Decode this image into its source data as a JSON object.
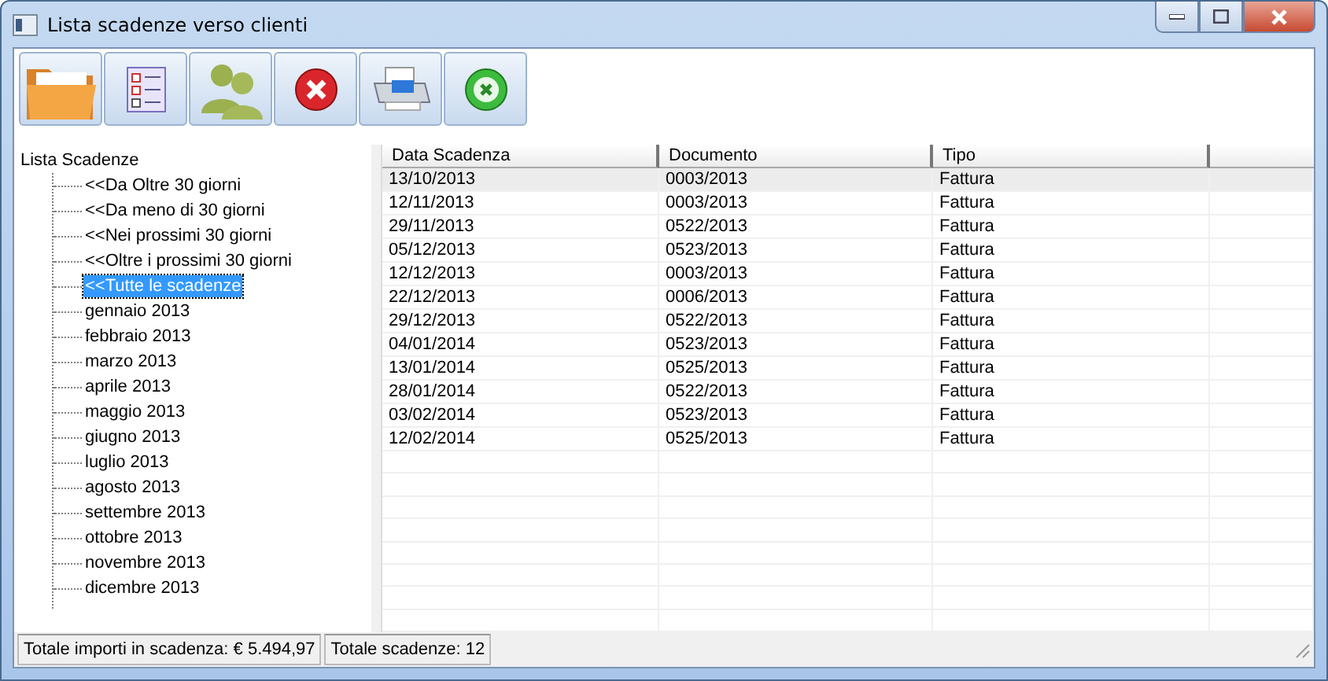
{
  "window": {
    "title": "Lista scadenze verso clienti"
  },
  "tree": {
    "label": "Lista Scadenze",
    "children": [
      {
        "label": "<<Da Oltre 30 giorni",
        "selected": false
      },
      {
        "label": "<<Da meno di 30 giorni",
        "selected": false
      },
      {
        "label": "<<Nei prossimi 30 giorni",
        "selected": false
      },
      {
        "label": "<<Oltre i prossimi 30 giorni",
        "selected": false
      },
      {
        "label": "<<Tutte le scadenze",
        "selected": true
      },
      {
        "label": "gennaio 2013",
        "selected": false
      },
      {
        "label": "febbraio 2013",
        "selected": false
      },
      {
        "label": "marzo 2013",
        "selected": false
      },
      {
        "label": "aprile 2013",
        "selected": false
      },
      {
        "label": "maggio 2013",
        "selected": false
      },
      {
        "label": "giugno 2013",
        "selected": false
      },
      {
        "label": "luglio 2013",
        "selected": false
      },
      {
        "label": "agosto 2013",
        "selected": false
      },
      {
        "label": "settembre 2013",
        "selected": false
      },
      {
        "label": "ottobre 2013",
        "selected": false
      },
      {
        "label": "novembre 2013",
        "selected": false
      },
      {
        "label": "dicembre 2013",
        "selected": false
      }
    ]
  },
  "table": {
    "columns": [
      "Data Scadenza",
      "Documento",
      "Tipo"
    ],
    "rows": [
      {
        "cells": [
          "13/10/2013",
          "0003/2013",
          "Fattura"
        ],
        "selected": true
      },
      {
        "cells": [
          "12/11/2013",
          "0003/2013",
          "Fattura"
        ],
        "selected": false
      },
      {
        "cells": [
          "29/11/2013",
          "0522/2013",
          "Fattura"
        ],
        "selected": false
      },
      {
        "cells": [
          "05/12/2013",
          "0523/2013",
          "Fattura"
        ],
        "selected": false
      },
      {
        "cells": [
          "12/12/2013",
          "0003/2013",
          "Fattura"
        ],
        "selected": false
      },
      {
        "cells": [
          "22/12/2013",
          "0006/2013",
          "Fattura"
        ],
        "selected": false
      },
      {
        "cells": [
          "29/12/2013",
          "0522/2013",
          "Fattura"
        ],
        "selected": false
      },
      {
        "cells": [
          "04/01/2014",
          "0523/2013",
          "Fattura"
        ],
        "selected": false
      },
      {
        "cells": [
          "13/01/2014",
          "0525/2013",
          "Fattura"
        ],
        "selected": false
      },
      {
        "cells": [
          "28/01/2014",
          "0522/2013",
          "Fattura"
        ],
        "selected": false
      },
      {
        "cells": [
          "03/02/2014",
          "0523/2013",
          "Fattura"
        ],
        "selected": false
      },
      {
        "cells": [
          "12/02/2014",
          "0525/2013",
          "Fattura"
        ],
        "selected": false
      }
    ]
  },
  "status_bar": [
    "Totale importi in scadenza: € 5.494,97",
    "Totale scadenze: 12"
  ]
}
